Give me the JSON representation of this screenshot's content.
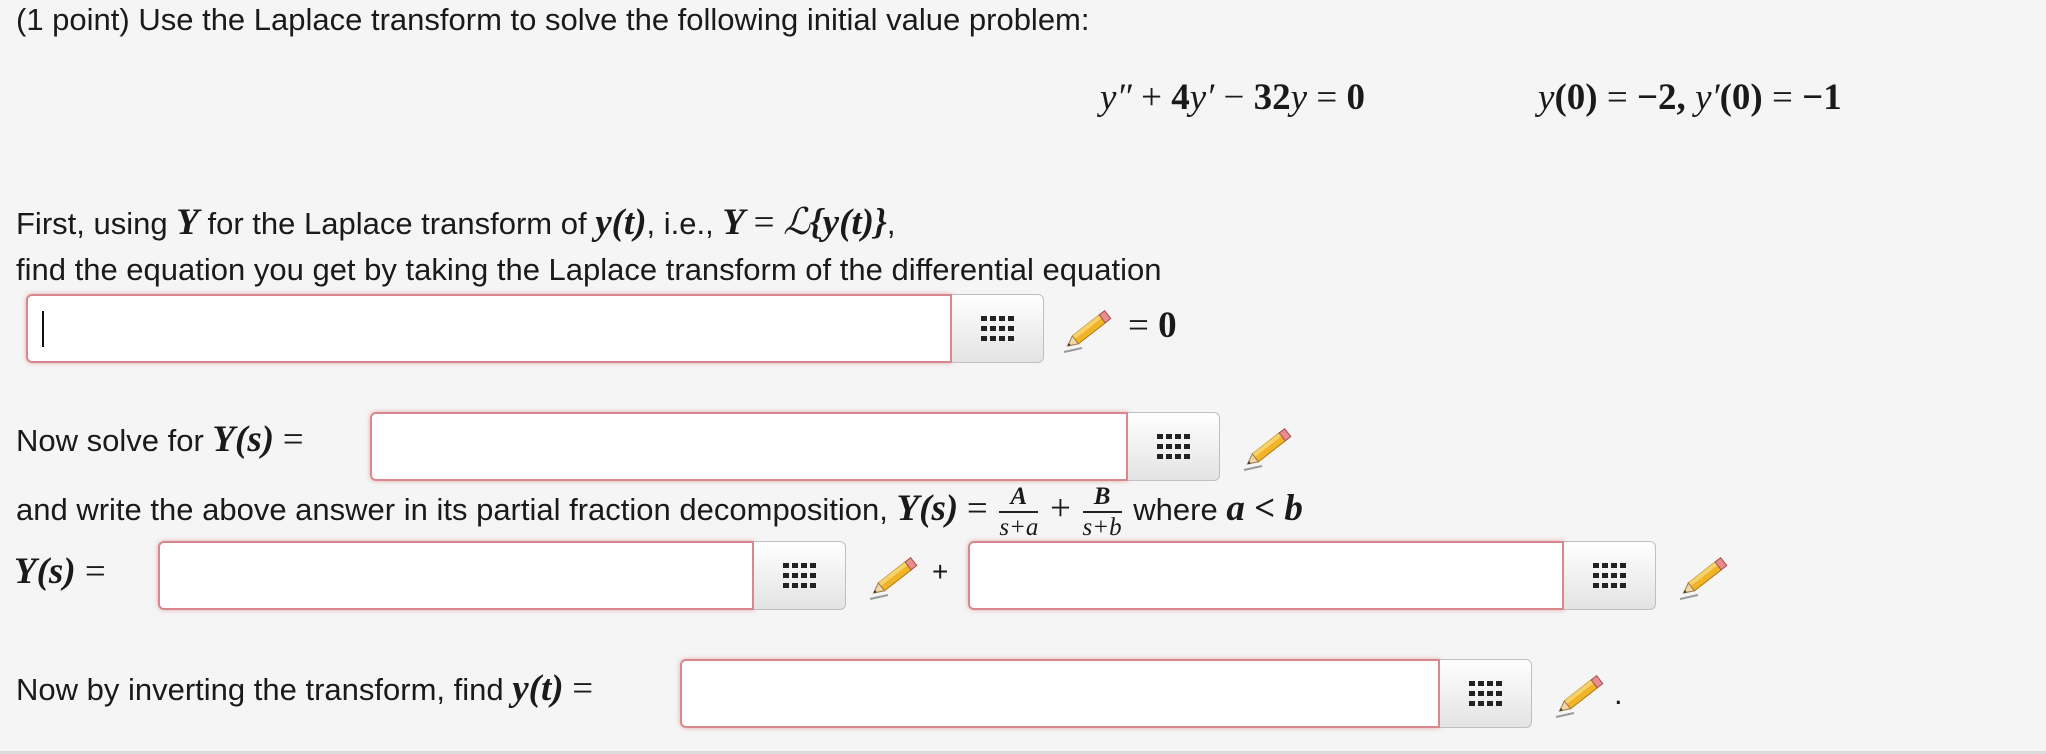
{
  "problem": {
    "intro": "(1 point) Use the Laplace transform to solve the following initial value problem:",
    "ode": {
      "y2": "y″",
      "plus1": "+",
      "coef4": "4",
      "y1": "y′",
      "minus": "−",
      "coef32": "32",
      "y0": "y",
      "eq": "=",
      "zero": "0"
    },
    "ic": {
      "y0_label": "y",
      "y0_arg": "(0)",
      "eq1": "=",
      "val1": "−2,",
      "yp_label": "y′",
      "yp_arg": "(0)",
      "eq2": "=",
      "val2": "−1"
    }
  },
  "step1": {
    "text_a": "First, using",
    "Y": "Y",
    "text_b": "for the Laplace transform of",
    "yt": "y(t)",
    "text_c": ", i.e.,",
    "Y2": "Y",
    "eq": "=",
    "L": "ℒ",
    "Lyt": "{y(t)}",
    "comma": ",",
    "line2": "find the equation you get by taking the Laplace transform of the differential equation",
    "suffix_eq": "=",
    "suffix_zero": "0"
  },
  "step2": {
    "text": "Now solve for",
    "Ys": "Y(s)",
    "eq": "="
  },
  "step3": {
    "text_a": "and write the above answer in its partial fraction decomposition,",
    "Ys": "Y(s)",
    "eq": "=",
    "frac1_num": "A",
    "frac1_den": "s+a",
    "plus": "+",
    "frac2_num": "B",
    "frac2_den": "s+b",
    "text_b": "where",
    "cond": "a < b",
    "Ys_label": "Y(s)",
    "Ys_eq": "=",
    "plus_between": "+"
  },
  "step4": {
    "text": "Now by inverting the transform, find",
    "yt": "y(t)",
    "eq": "=",
    "period": "."
  },
  "answers": {
    "transform": "",
    "Ys": "",
    "partA": "",
    "partB": "",
    "yt": ""
  },
  "colors": {
    "field_border": "#d8888d",
    "background": "#f5f5f5"
  }
}
